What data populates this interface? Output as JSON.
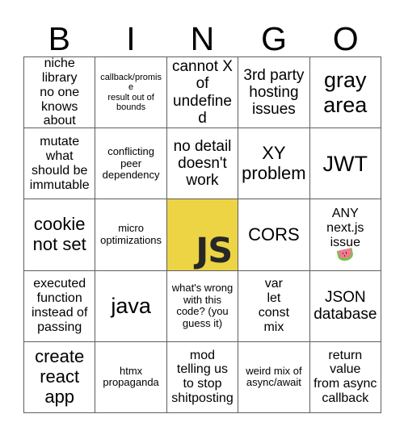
{
  "header": {
    "letters": [
      "B",
      "I",
      "N",
      "G",
      "O"
    ]
  },
  "colors": {
    "free_space_background": "#edd445",
    "free_space_text": "#272727",
    "grid_line": "#5e5e5e",
    "page_background": "#ffffff",
    "text": "#000000"
  },
  "grid": {
    "rows": 5,
    "columns": 5,
    "cells": [
      {
        "text": "niche library\nno one\nknows\nabout",
        "size": "md",
        "free": false
      },
      {
        "text": "callback/promise\nresult out of\nbounds",
        "size": "xs",
        "free": false
      },
      {
        "text": "cannot X\nof\nundefined",
        "size": "lg",
        "free": false
      },
      {
        "text": "3rd party\nhosting\nissues",
        "size": "lg",
        "free": false
      },
      {
        "text": "gray\narea",
        "size": "xxl",
        "free": false
      },
      {
        "text": "mutate\nwhat\nshould be\nimmutable",
        "size": "md",
        "free": false
      },
      {
        "text": "conflicting\npeer\ndependency",
        "size": "sm",
        "free": false
      },
      {
        "text": "no detail\ndoesn't\nwork",
        "size": "lg",
        "free": false
      },
      {
        "text": "XY\nproblem",
        "size": "xl",
        "free": false
      },
      {
        "text": "JWT",
        "size": "xxl",
        "free": false
      },
      {
        "text": "cookie\nnot set",
        "size": "xl",
        "free": false
      },
      {
        "text": "micro\noptimizations",
        "size": "sm",
        "free": false
      },
      {
        "text": "JS",
        "size": "xxl",
        "free": true
      },
      {
        "text": "CORS",
        "size": "xl",
        "free": false
      },
      {
        "text": "ANY\nnext.js\nissue",
        "size": "md",
        "free": false,
        "emoji": "watermelon-emoji"
      },
      {
        "text": "executed\nfunction\ninstead of\npassing",
        "size": "md",
        "free": false
      },
      {
        "text": "java",
        "size": "xxl",
        "free": false
      },
      {
        "text": "what's wrong\nwith this\ncode? (you\nguess it)",
        "size": "sm",
        "free": false
      },
      {
        "text": "var\nlet\nconst\nmix",
        "size": "md",
        "free": false
      },
      {
        "text": "JSON\ndatabase",
        "size": "lg",
        "free": false
      },
      {
        "text": "create\nreact\napp",
        "size": "xl",
        "free": false
      },
      {
        "text": "htmx\npropaganda",
        "size": "sm",
        "free": false
      },
      {
        "text": "mod\ntelling us\nto stop\nshitposting",
        "size": "md",
        "free": false
      },
      {
        "text": "weird mix of\nasync/await",
        "size": "sm",
        "free": false
      },
      {
        "text": "return\nvalue\nfrom async\ncallback",
        "size": "md",
        "free": false
      }
    ]
  }
}
